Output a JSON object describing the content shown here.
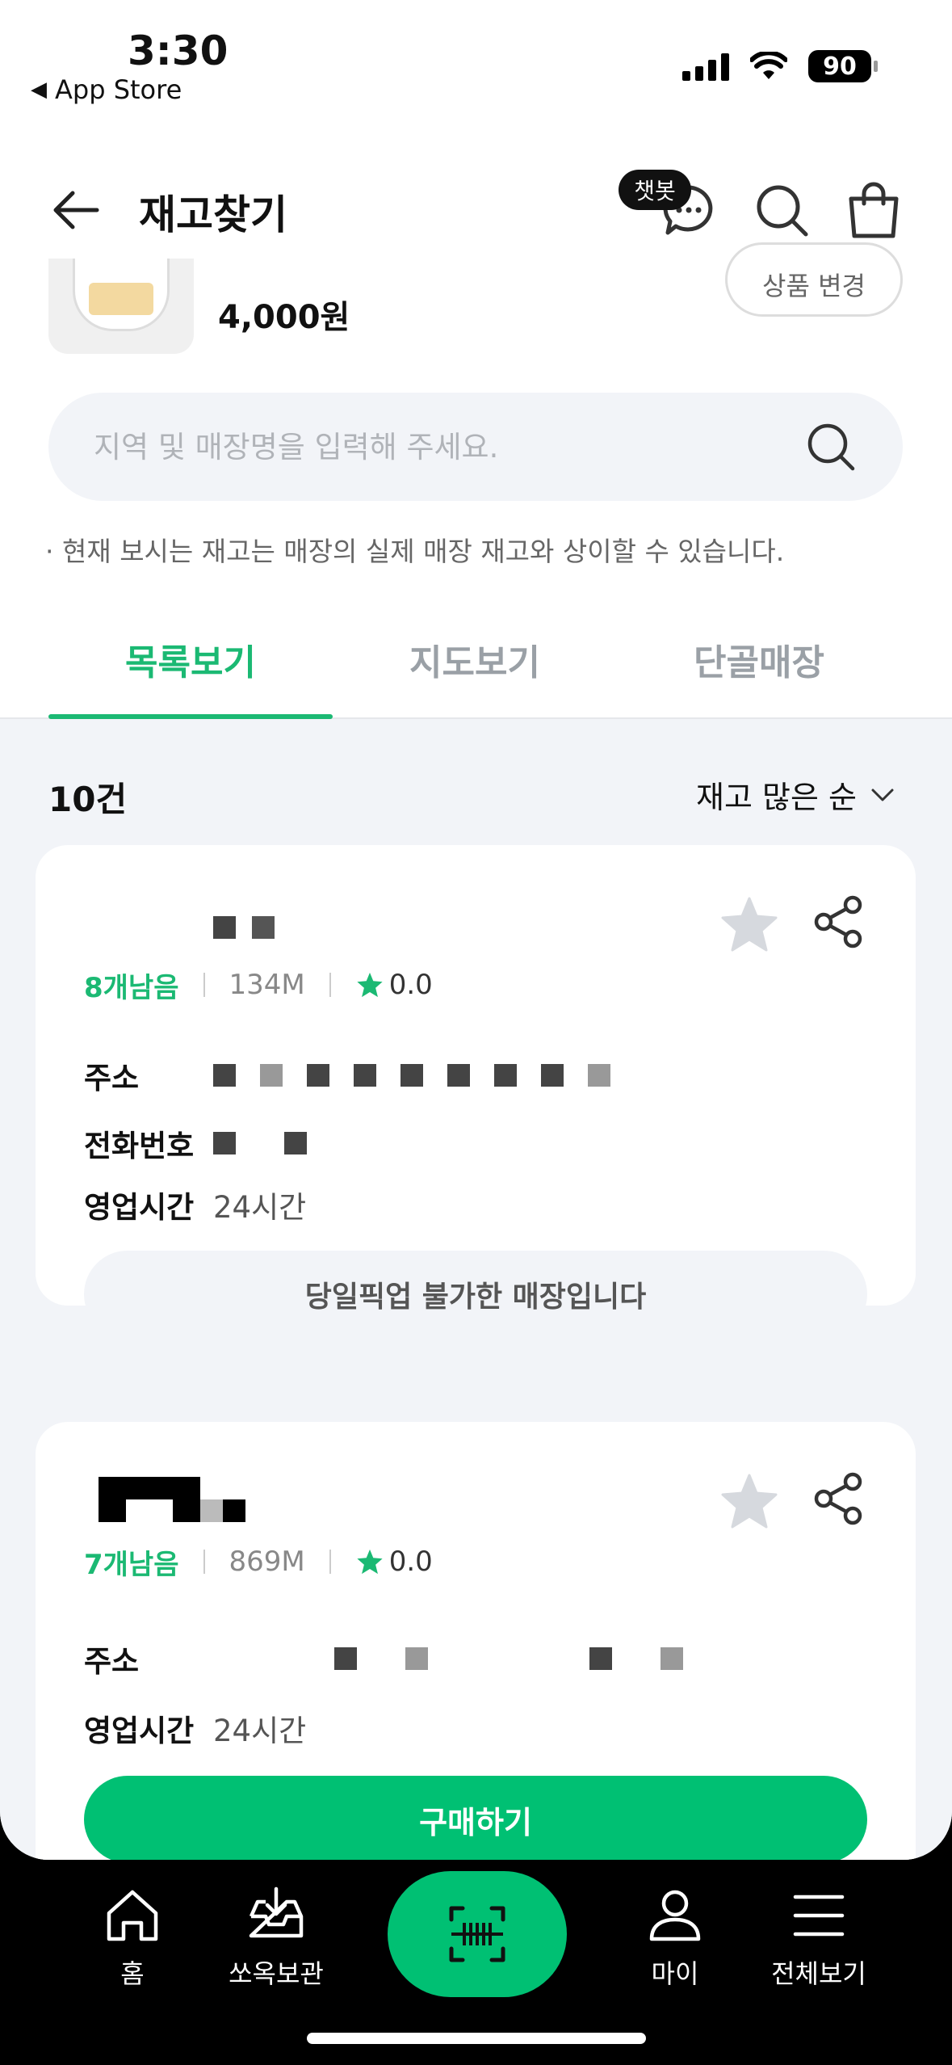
{
  "status_bar": {
    "time": "3:30",
    "back_app": "App Store",
    "battery": "90"
  },
  "header": {
    "title": "재고찾기",
    "chatbot_badge": "챗봇"
  },
  "product": {
    "price": "4,000원",
    "change_button": "상품 변경"
  },
  "search": {
    "placeholder": "지역 및 매장명을 입력해 주세요."
  },
  "notice": "· 현재 보시는 재고는 매장의 실제 매장 재고와 상이할 수 있습니다.",
  "tabs": [
    {
      "label": "목록보기",
      "active": true
    },
    {
      "label": "지도보기",
      "active": false
    },
    {
      "label": "단골매장",
      "active": false
    }
  ],
  "list": {
    "count": "10건",
    "sort": "재고 많은 순",
    "stores": [
      {
        "stock": "8개남음",
        "distance": "134M",
        "rating": "0.0",
        "address_label": "주소",
        "phone_label": "전화번호",
        "hours_label": "영업시간",
        "hours": "24시간",
        "pickup": "당일픽업 불가한 매장입니다"
      },
      {
        "stock": "7개남음",
        "distance": "869M",
        "rating": "0.0",
        "address_label": "주소",
        "hours_label": "영업시간",
        "hours": "24시간",
        "buy": "구매하기"
      }
    ]
  },
  "nav": {
    "home": "홈",
    "storage": "쏘옥보관",
    "my": "마이",
    "all": "전체보기"
  },
  "colors": {
    "accent": "#00c073",
    "tab_active": "#1bb973",
    "surface": "#f2f4f8"
  }
}
